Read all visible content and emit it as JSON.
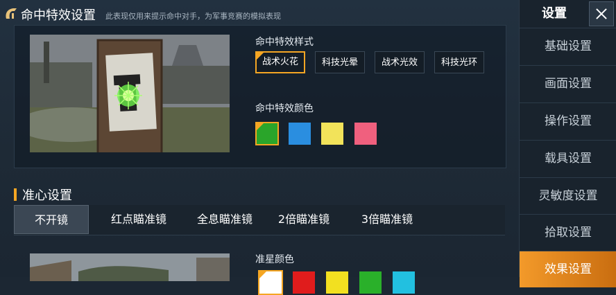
{
  "header": {
    "title": "命中特效设置",
    "subtitle": "此表现仅用来提示命中对手，为军事竞赛的模拟表现"
  },
  "hit_effect": {
    "style_label": "命中特效样式",
    "styles": [
      {
        "label": "战术火花",
        "selected": true
      },
      {
        "label": "科技光晕",
        "selected": false
      },
      {
        "label": "战术光效",
        "selected": false
      },
      {
        "label": "科技光环",
        "selected": false
      }
    ],
    "color_label": "命中特效颜色",
    "colors": [
      {
        "color": "#2aa52a",
        "selected": true
      },
      {
        "color": "#2a8ee0",
        "selected": false
      },
      {
        "color": "#f2e35a",
        "selected": false
      },
      {
        "color": "#f0607e",
        "selected": false
      }
    ]
  },
  "crosshair": {
    "title": "准心设置",
    "tabs": [
      {
        "label": "不开镜",
        "active": true
      },
      {
        "label": "红点瞄准镜",
        "active": false
      },
      {
        "label": "全息瞄准镜",
        "active": false
      },
      {
        "label": "2倍瞄准镜",
        "active": false
      },
      {
        "label": "3倍瞄准镜",
        "active": false
      }
    ],
    "color_label": "准星颜色",
    "colors": [
      {
        "color": "#ffffff",
        "selected": true
      },
      {
        "color": "#e01c1c",
        "selected": false
      },
      {
        "color": "#f2e020",
        "selected": false
      },
      {
        "color": "#2ab02a",
        "selected": false
      },
      {
        "color": "#22c0e0",
        "selected": false
      }
    ]
  },
  "sidebar": {
    "title": "设置",
    "items": [
      {
        "label": "基础设置",
        "active": false
      },
      {
        "label": "画面设置",
        "active": false
      },
      {
        "label": "操作设置",
        "active": false
      },
      {
        "label": "载具设置",
        "active": false
      },
      {
        "label": "灵敏度设置",
        "active": false
      },
      {
        "label": "拾取设置",
        "active": false
      },
      {
        "label": "效果设置",
        "active": true
      }
    ]
  },
  "colors": {
    "accent": "#f5a623",
    "panel": "#1c2733"
  }
}
